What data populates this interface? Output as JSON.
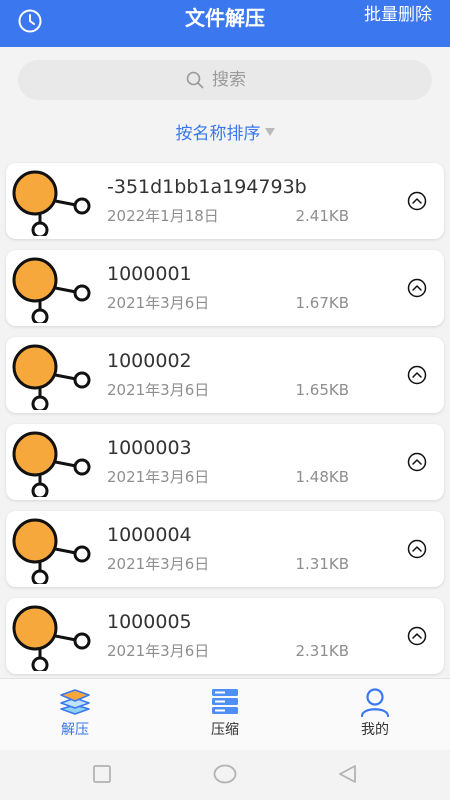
{
  "header": {
    "title": "文件解压",
    "batch_delete_label": "批量删除",
    "background_color": "#3b78ef"
  },
  "search": {
    "placeholder": "搜索"
  },
  "sort": {
    "label": "按名称排序"
  },
  "files": [
    {
      "name": "-351d1bb1a194793b",
      "date": "2022年1月18日",
      "size": "2.41KB"
    },
    {
      "name": "1000001",
      "date": "2021年3月6日",
      "size": "1.67KB"
    },
    {
      "name": "1000002",
      "date": "2021年3月6日",
      "size": "1.65KB"
    },
    {
      "name": "1000003",
      "date": "2021年3月6日",
      "size": "1.48KB"
    },
    {
      "name": "1000004",
      "date": "2021年3月6日",
      "size": "1.31KB"
    },
    {
      "name": "1000005",
      "date": "2021年3月6日",
      "size": "2.31KB"
    }
  ],
  "bottom_nav": {
    "items": [
      {
        "label": "解压",
        "icon": "layers-icon",
        "active": true
      },
      {
        "label": "压缩",
        "icon": "compress-icon",
        "active": false
      },
      {
        "label": "我的",
        "icon": "user-icon",
        "active": false
      }
    ],
    "active_color": "#3b78ef"
  },
  "system_nav": {
    "buttons": [
      "recent-apps-icon",
      "home-icon",
      "back-icon"
    ]
  }
}
